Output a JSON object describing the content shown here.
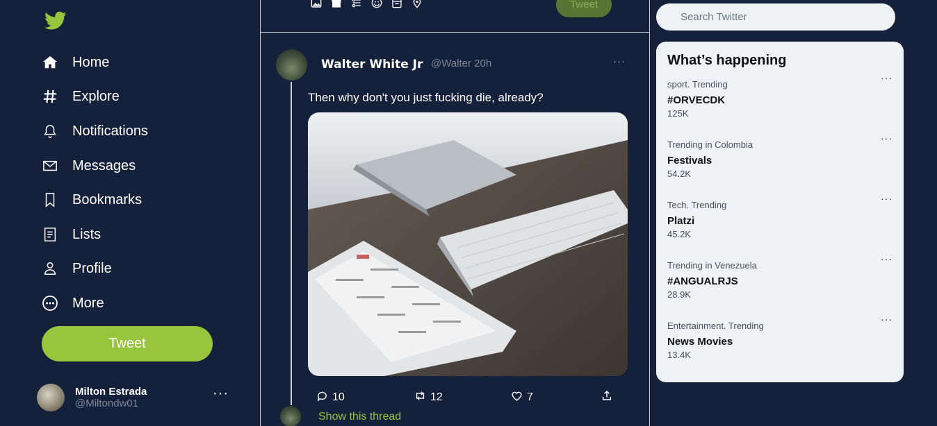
{
  "sidebar": {
    "logo_icon": "twitter-bird-icon",
    "nav": [
      {
        "label": "Home",
        "icon": "home-icon"
      },
      {
        "label": "Explore",
        "icon": "hashtag-icon"
      },
      {
        "label": "Notifications",
        "icon": "bell-icon"
      },
      {
        "label": "Messages",
        "icon": "envelope-icon"
      },
      {
        "label": "Bookmarks",
        "icon": "bookmark-icon"
      },
      {
        "label": "Lists",
        "icon": "list-icon"
      },
      {
        "label": "Profile",
        "icon": "person-icon"
      },
      {
        "label": "More",
        "icon": "more-circle-icon"
      }
    ],
    "tweet_button": "Tweet",
    "account": {
      "name": "Milton Estrada",
      "handle": "@Miltondw01",
      "more": "···"
    }
  },
  "composer": {
    "icons": [
      "image-icon",
      "gif-icon",
      "poll-icon",
      "emoji-icon",
      "schedule-icon",
      "location-icon"
    ],
    "tweet_button": "Tweet"
  },
  "tweet": {
    "author": "Walter White Jr",
    "meta": "@Walter 20h",
    "more": "···",
    "text": "Then why don't you just fucking die, already?",
    "actions": {
      "replies": "10",
      "retweets": "12",
      "likes": "7"
    },
    "show_thread": "Show this thread"
  },
  "search": {
    "placeholder": "Search Twitter"
  },
  "trends": {
    "title": "What’s happening",
    "items": [
      {
        "category": "sport. Trending",
        "name": "#ORVECDK",
        "count": "125K"
      },
      {
        "category": "Trending in Colombia",
        "name": "Festivals",
        "count": "54.2K"
      },
      {
        "category": "Tech. Trending",
        "name": "Platzi",
        "count": "45.2K"
      },
      {
        "category": "Trending in Venezuela",
        "name": "#ANGUALRJS",
        "count": "28.9K"
      },
      {
        "category": "Entertainment. Trending",
        "name": "News Movies",
        "count": "13.4K"
      }
    ]
  },
  "colors": {
    "background": "#15203b",
    "accent": "#97c53b",
    "panel": "#eef2f4"
  }
}
